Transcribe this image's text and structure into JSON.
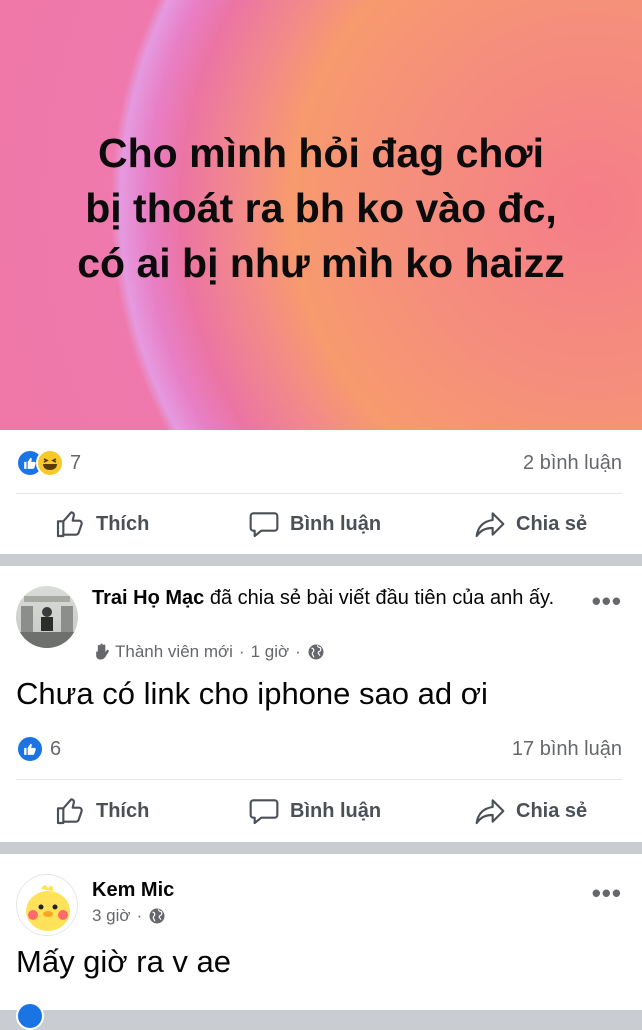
{
  "post1": {
    "banner_text": "Cho mình hỏi đag chơi\nbị thoát ra bh ko vào đc,\ncó ai bị như mìh ko haizz",
    "reaction_count": "7",
    "comment_count": "2 bình luận",
    "colors": {
      "banner": "#ef78a8",
      "like": "#1b74e4",
      "haha": "#f7c928"
    }
  },
  "post2": {
    "author": "Trai Họ Mạc",
    "action_text": " đã chia sẻ bài viết đầu tiên của anh ấy.",
    "badge": "Thành viên mới",
    "time": "1 giờ",
    "separator": "·",
    "body": "Chưa có link cho iphone sao ad ơi",
    "reaction_count": "6",
    "comment_count": "17 bình luận"
  },
  "post3": {
    "author": "Kem Mic",
    "time": "3 giờ",
    "separator": "·",
    "body": "Mấy giờ ra v ae"
  },
  "actions": {
    "like": "Thích",
    "comment": "Bình luận",
    "share": "Chia sẻ"
  },
  "more_label": "•••"
}
